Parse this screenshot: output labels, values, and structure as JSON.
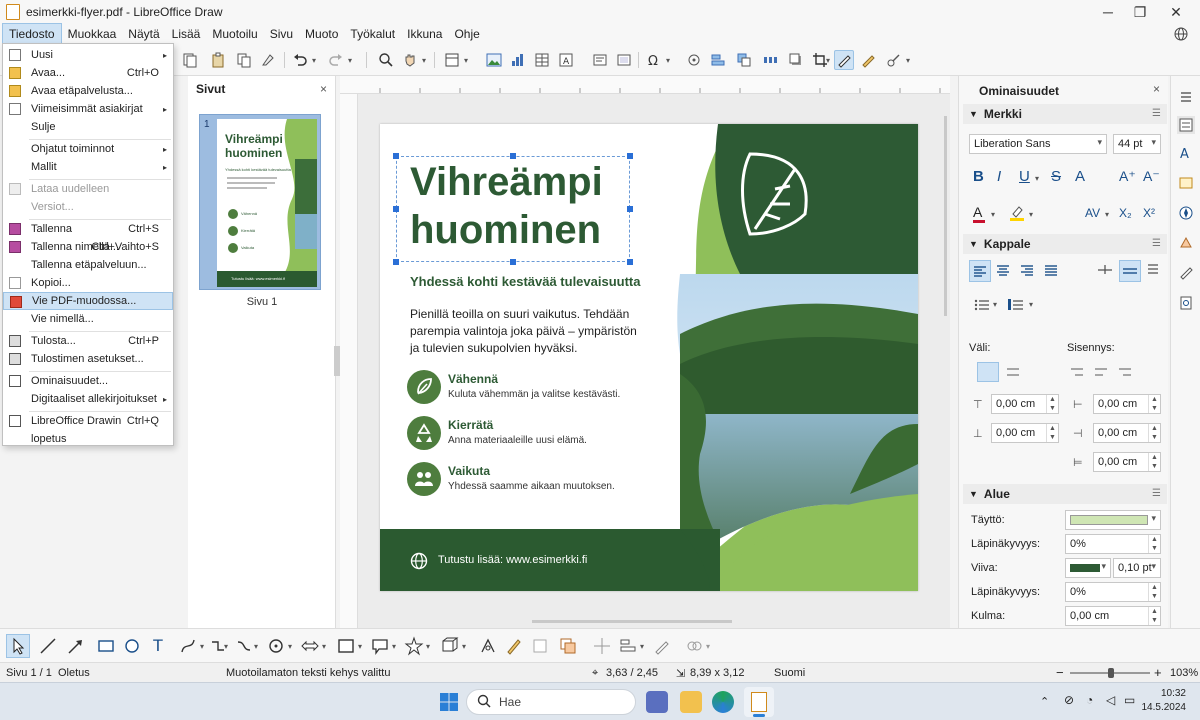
{
  "window": {
    "title": "esimerkki-flyer.pdf - LibreOffice Draw",
    "minimize": "─",
    "maximize": "❐",
    "close": "✕"
  },
  "menubar": [
    "Tiedosto",
    "Muokkaa",
    "Näytä",
    "Lisää",
    "Muotoilu",
    "Sivu",
    "Muoto",
    "Työkalut",
    "Ikkuna",
    "Ohje"
  ],
  "file_menu": [
    {
      "label": "Uusi",
      "shortcut": "",
      "submenu": true
    },
    {
      "label": "Avaa...",
      "shortcut": "Ctrl+O",
      "submenu": false
    },
    {
      "label": "Avaa etäpalvelusta...",
      "shortcut": "",
      "submenu": false
    },
    {
      "label": "Viimeisimmät asiakirjat",
      "shortcut": "",
      "submenu": true
    },
    {
      "label": "Sulje",
      "shortcut": "",
      "submenu": false
    },
    {
      "label": "Ohjatut toiminnot",
      "shortcut": "",
      "submenu": true
    },
    {
      "label": "Mallit",
      "shortcut": "",
      "submenu": true
    },
    {
      "label": "Lataa uudelleen",
      "shortcut": "",
      "submenu": false
    },
    {
      "label": "Versiot...",
      "shortcut": "",
      "submenu": false
    },
    {
      "label": "Tallenna",
      "shortcut": "Ctrl+S",
      "submenu": false
    },
    {
      "label": "Tallenna nimellä...",
      "shortcut": "Ctrl+Vaihto+S",
      "submenu": false
    },
    {
      "label": "Tallenna etäpalveluun...",
      "shortcut": "",
      "submenu": false
    },
    {
      "label": "Kopioi...",
      "shortcut": "",
      "submenu": false
    },
    {
      "label": "Vie PDF-muodossa...",
      "shortcut": "",
      "submenu": false
    },
    {
      "label": "Vie nimellä...",
      "shortcut": "",
      "submenu": false
    },
    {
      "label": "Tulosta...",
      "shortcut": "Ctrl+P",
      "submenu": false
    },
    {
      "label": "Tulostimen asetukset...",
      "shortcut": "",
      "submenu": false
    },
    {
      "label": "Ominaisuudet...",
      "shortcut": "",
      "submenu": false
    },
    {
      "label": "Digitaaliset allekirjoitukset",
      "shortcut": "",
      "submenu": true
    },
    {
      "label": "LibreOffice Drawin",
      "shortcut": "Ctrl+Q",
      "submenu": false
    },
    {
      "label": "lopetus",
      "shortcut": "",
      "submenu": false
    }
  ],
  "pages_panel": {
    "title": "Sivut",
    "close": "×",
    "thumb_number": "1",
    "thumb_label": "Sivu 1"
  },
  "thumbnail": {
    "title_line1": "Vihreämpi",
    "title_line2": "huominen",
    "subtitle": "Yhdessä kohti kestävää tulevaisuutta",
    "items": [
      "Vähennä",
      "Kierrätä",
      "Vaikuta"
    ],
    "footer": "Tutustu lisää: www.esimerkki.fi"
  },
  "flyer": {
    "title_line1": "Vihreämpi",
    "title_line2": "huominen",
    "subtitle": "Yhdessä kohti kestävää tulevaisuutta",
    "body": [
      "Pienillä teoilla on suuri vaikutus. Tehdään",
      "parempia valintoja joka päivä – ympäristön",
      "ja tulevien sukupolvien hyväksi."
    ],
    "items": [
      {
        "title": "Vähennä",
        "desc": "Kuluta vähemmän ja valitse kestävästi.",
        "icon": "leaf-icon"
      },
      {
        "title": "Kierrätä",
        "desc": "Anna materiaaleille uusi elämä.",
        "icon": "recycle-icon"
      },
      {
        "title": "Vaikuta",
        "desc": "Yhdessä saamme aikaan muutoksen.",
        "icon": "people-icon"
      }
    ],
    "footer": "Tutustu lisää: www.esimerkki.fi",
    "colors": {
      "dark_green": "#2d5a34",
      "mid_green": "#4e7d3e",
      "light_green": "#8fbf5a",
      "footer_green": "#2b5a30"
    }
  },
  "properties": {
    "title": "Ominaisuudet",
    "close": "×",
    "sections": {
      "character": "Merkki",
      "paragraph": "Kappale",
      "area": "Alue"
    },
    "font_name": "Liberation Sans",
    "font_size": "44 pt",
    "spacing_label": "Väli:",
    "indent_label": "Sisennys:",
    "spacing_above": "0,00 cm",
    "spacing_below": "0,00 cm",
    "indent_before": "0,00 cm",
    "indent_after": "0,00 cm",
    "indent_first": "0,00 cm",
    "fill_label": "Täyttö:",
    "fill_transparency_label": "Läpinäkyvyys:",
    "fill_transparency": "0%",
    "line_label": "Viiva:",
    "line_width": "0,10 pt",
    "line_transparency_label": "Läpinäkyvyys:",
    "line_transparency": "0%",
    "angle_label": "Kulma:",
    "angle": "0,00 cm",
    "fill_color": "#cfe6b4",
    "line_color": "#2d5a34"
  },
  "statusbar": {
    "page": "Sivu 1 / 1",
    "layout": "Oletus",
    "selection": "Muotoilamaton teksti kehys valittu",
    "position": "3,63 / 2,45",
    "size": "8,39 x 3,12",
    "language": "Suomi",
    "zoom_minus": "−",
    "zoom_plus": "+",
    "zoom": "103%"
  },
  "taskbar": {
    "search": "Hae",
    "time": "10:32",
    "date": "14.5.2024"
  }
}
